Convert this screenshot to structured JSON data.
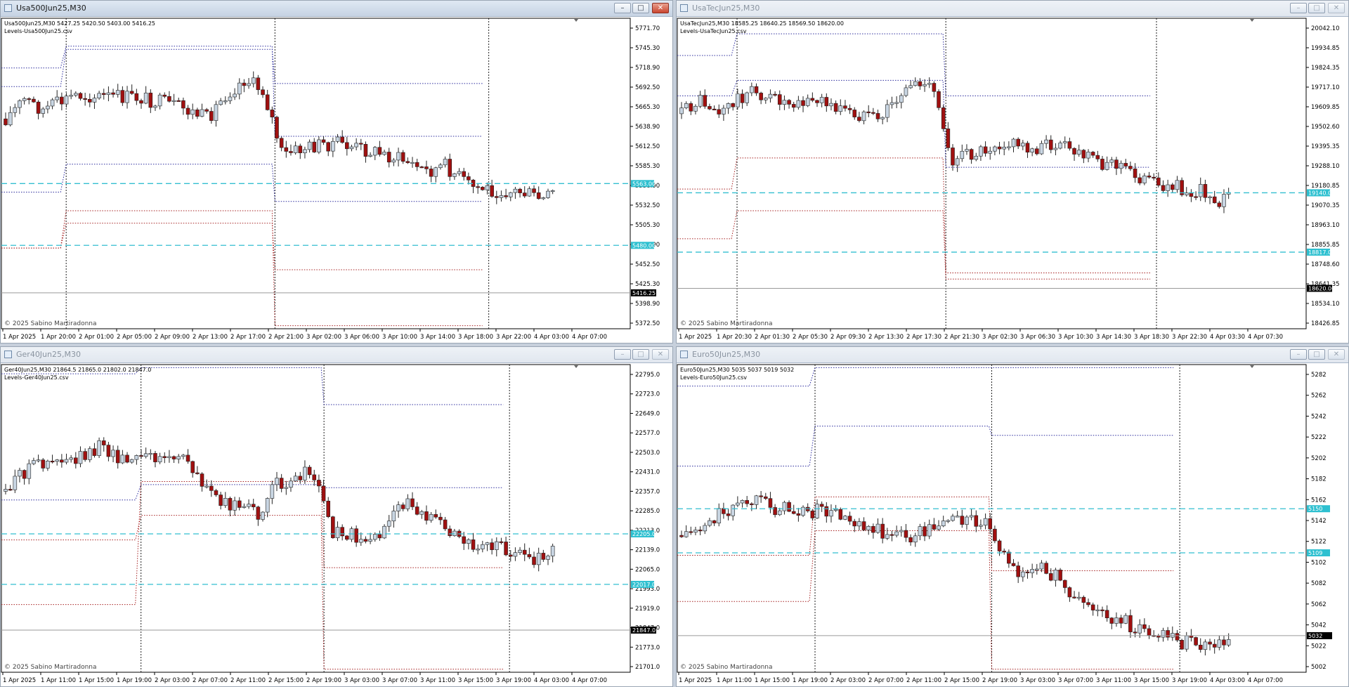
{
  "colors": {
    "bull_body": "#c9d6e3",
    "bear_body": "#a01010",
    "candle_outline": "#222222",
    "level_blue": "#2c2c9e",
    "level_red": "#a62020",
    "cyan_line": "#33bfd0",
    "cyan_label_bg": "#2ec0d0",
    "price_label_bg": "#000000"
  },
  "windows": [
    {
      "id": "usa500",
      "title": "Usa500Jun25,M30",
      "active": true,
      "info_line": "Usa500Jun25,M30  5427.25 5420.50 5403.00 5416.25",
      "levels_file": "Levels-Usa500Jun25.csv",
      "copyright": "© 2025 Sabino Martiradonna",
      "price_labels": [
        "5771.70",
        "5745.30",
        "5718.90",
        "5692.50",
        "5665.30",
        "5638.90",
        "5612.50",
        "5585.30",
        "5558.90",
        "5532.50",
        "5505.30",
        "5478.90",
        "5452.50",
        "5425.30",
        "5398.90",
        "5372.50"
      ],
      "time_labels": [
        "1 Apr 2025",
        "1 Apr 20:00",
        "2 Apr 01:00",
        "2 Apr 05:00",
        "2 Apr 09:00",
        "2 Apr 13:00",
        "2 Apr 17:00",
        "2 Apr 21:00",
        "3 Apr 02:00",
        "3 Apr 06:00",
        "3 Apr 10:00",
        "3 Apr 14:00",
        "3 Apr 18:00",
        "3 Apr 22:00",
        "4 Apr 03:00",
        "4 Apr 07:00"
      ],
      "cyan_levels": [
        {
          "price": 5563.0,
          "label": "5563.00"
        },
        {
          "price": 5480.0,
          "label": "5480.00"
        }
      ],
      "current_price": {
        "price": 5416.25,
        "label": "5416.25"
      },
      "ymin": 5368,
      "ymax": 5785
    },
    {
      "id": "usatec",
      "title": "UsaTecJun25,M30",
      "active": false,
      "info_line": "UsaTecJun25,M30  18585.25 18640.25 18569.50 18620.00",
      "levels_file": "Levels-UsaTecJun25.csv",
      "copyright": "© 2025 Sabino Martiradonna",
      "price_labels": [
        "20042.10",
        "19934.85",
        "19824.35",
        "19717.10",
        "19609.85",
        "19502.60",
        "19395.35",
        "19288.10",
        "19180.85",
        "19070.35",
        "18963.10",
        "18855.85",
        "18748.60",
        "18641.35",
        "18534.10",
        "18426.85"
      ],
      "time_labels": [
        "1 Apr 2025",
        "1 Apr 20:30",
        "2 Apr 01:30",
        "2 Apr 05:30",
        "2 Apr 09:30",
        "2 Apr 13:30",
        "2 Apr 17:30",
        "2 Apr 21:30",
        "3 Apr 02:30",
        "3 Apr 06:30",
        "3 Apr 10:30",
        "3 Apr 14:30",
        "3 Apr 18:30",
        "3 Apr 22:30",
        "4 Apr 03:30",
        "4 Apr 07:30"
      ],
      "cyan_levels": [
        {
          "price": 19140.0,
          "label": "19140.00"
        },
        {
          "price": 18817.0,
          "label": "18817.00"
        }
      ],
      "current_price": {
        "price": 18620.0,
        "label": "18620.00"
      },
      "ymin": 18400,
      "ymax": 20090
    },
    {
      "id": "ger40",
      "title": "Ger40Jun25,M30",
      "active": false,
      "info_line": "Ger40Jun25,M30  21864.5 21865.0 21802.0 21847.0",
      "levels_file": "Levels-Ger40Jun25.csv",
      "copyright": "© 2025 Sabino Martiradonna",
      "price_labels": [
        "22795.0",
        "22723.0",
        "22649.0",
        "22577.0",
        "22503.0",
        "22431.0",
        "22357.0",
        "22285.0",
        "22213.0",
        "22139.0",
        "22065.0",
        "21993.0",
        "21919.0",
        "21847.0",
        "21773.0",
        "21701.0"
      ],
      "time_labels": [
        "1 Apr 2025",
        "1 Apr 11:00",
        "1 Apr 15:00",
        "1 Apr 19:00",
        "2 Apr 03:00",
        "2 Apr 07:00",
        "2 Apr 11:00",
        "2 Apr 15:00",
        "2 Apr 19:00",
        "3 Apr 03:00",
        "3 Apr 07:00",
        "3 Apr 11:00",
        "3 Apr 15:00",
        "3 Apr 19:00",
        "4 Apr 03:00",
        "4 Apr 07:00"
      ],
      "cyan_levels": [
        {
          "price": 22205.0,
          "label": "22205.0"
        },
        {
          "price": 22017.0,
          "label": "22017.0"
        }
      ],
      "current_price": {
        "price": 21847.0,
        "label": "21847.0"
      },
      "ymin": 21690,
      "ymax": 22835
    },
    {
      "id": "euro50",
      "title": "Euro50Jun25,M30",
      "active": false,
      "info_line": "Euro50Jun25,M30  5035 5037 5019 5032",
      "levels_file": "Levels-Euro50Jun25.csv",
      "copyright": "© 2025 Sabino Martiradonna",
      "price_labels": [
        "5282",
        "5262",
        "5242",
        "5222",
        "5202",
        "5182",
        "5162",
        "5142",
        "5122",
        "5102",
        "5082",
        "5062",
        "5042",
        "5022",
        "5002"
      ],
      "time_labels": [
        "1 Apr 2025",
        "1 Apr 11:00",
        "1 Apr 15:00",
        "1 Apr 19:00",
        "2 Apr 03:00",
        "2 Apr 07:00",
        "2 Apr 11:00",
        "2 Apr 15:00",
        "2 Apr 19:00",
        "3 Apr 03:00",
        "3 Apr 07:00",
        "3 Apr 11:00",
        "3 Apr 15:00",
        "3 Apr 19:00",
        "4 Apr 03:00",
        "4 Apr 07:00"
      ],
      "cyan_levels": [
        {
          "price": 5150,
          "label": "5150"
        },
        {
          "price": 5109,
          "label": "5109"
        }
      ],
      "current_price": {
        "price": 5032,
        "label": "5032"
      },
      "ymin": 4998,
      "ymax": 5284
    }
  ],
  "window_buttons": {
    "minimize": "–",
    "maximize": "□",
    "close": "✕"
  }
}
